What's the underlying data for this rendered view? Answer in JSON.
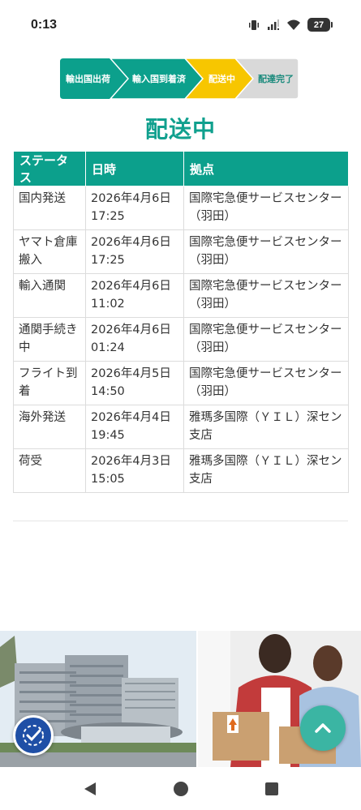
{
  "status_bar": {
    "time": "0:13",
    "battery": "27"
  },
  "steps": [
    {
      "label": "輸出国出荷",
      "state": "done",
      "color": "#0ca08c"
    },
    {
      "label": "輸入国到着済",
      "state": "done",
      "color": "#0ca08c"
    },
    {
      "label": "配送中",
      "state": "current",
      "color": "#f7c600"
    },
    {
      "label": "配達完了",
      "state": "pending",
      "color": "#d9d9d9"
    }
  ],
  "title": "配送中",
  "table": {
    "headers": [
      "ステータス",
      "日時",
      "拠点"
    ],
    "rows": [
      {
        "status": "国内発送",
        "datetime": "2026年4月6日 17:25",
        "location": "国際宅急便サービスセンター（羽田）"
      },
      {
        "status": "ヤマト倉庫搬入",
        "datetime": "2026年4月6日 17:25",
        "location": "国際宅急便サービスセンター（羽田）"
      },
      {
        "status": "輸入通関",
        "datetime": "2026年4月6日 11:02",
        "location": "国際宅急便サービスセンター（羽田）"
      },
      {
        "status": "通関手続き中",
        "datetime": "2026年4月6日 01:24",
        "location": "国際宅急便サービスセンター（羽田）"
      },
      {
        "status": "フライト到着",
        "datetime": "2026年4月5日 14:50",
        "location": "国際宅急便サービスセンター（羽田）"
      },
      {
        "status": "海外発送",
        "datetime": "2026年4月4日 19:45",
        "location": "雅瑪多国際（ＹＩＬ）深セン支店"
      },
      {
        "status": "荷受",
        "datetime": "2026年4月3日 15:05",
        "location": "雅瑪多国際（ＹＩＬ）深セン支店"
      }
    ]
  },
  "icons": {
    "accessibility": "accessibility-icon",
    "back_to_top": "chevron-up-icon",
    "nav_back": "back-triangle-icon",
    "nav_home": "home-circle-icon",
    "nav_recents": "recents-square-icon"
  },
  "colors": {
    "accent": "#0ca08c",
    "current_step": "#f7c600",
    "pending_step": "#d9d9d9"
  }
}
